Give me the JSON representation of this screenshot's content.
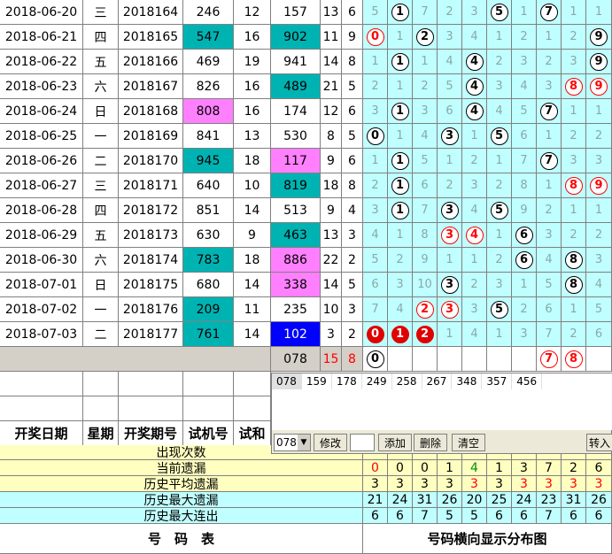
{
  "colors": {
    "teal": "#00b3b3",
    "pink": "#ff80ff",
    "blue": "#0000ff",
    "dist_bg": "#c0ffff",
    "ball_red": "#e00000"
  },
  "rows": [
    {
      "date": "2018-06-20",
      "weekday": "三",
      "issue": "2018164",
      "trial": "246",
      "trial_sum": "12",
      "draw": "157",
      "draw_sum": "13",
      "span": "6",
      "trial_style": "",
      "draw_style": "",
      "dist": [
        {
          "t": "5"
        },
        {
          "t": "1",
          "b": "blk"
        },
        {
          "t": "7"
        },
        {
          "t": "2"
        },
        {
          "t": "3"
        },
        {
          "t": "5",
          "b": "blk"
        },
        {
          "t": "1"
        },
        {
          "t": "7",
          "b": "blk"
        },
        {
          "t": "1"
        },
        {
          "t": "1"
        }
      ]
    },
    {
      "date": "2018-06-21",
      "weekday": "四",
      "issue": "2018165",
      "trial": "547",
      "trial_sum": "16",
      "draw": "902",
      "draw_sum": "11",
      "span": "9",
      "trial_style": "teal",
      "draw_style": "teal",
      "dist": [
        {
          "t": "0",
          "b": "red"
        },
        {
          "t": "1"
        },
        {
          "t": "2",
          "b": "blk"
        },
        {
          "t": "3"
        },
        {
          "t": "4"
        },
        {
          "t": "1"
        },
        {
          "t": "2"
        },
        {
          "t": "1"
        },
        {
          "t": "2"
        },
        {
          "t": "9",
          "b": "blk"
        }
      ]
    },
    {
      "date": "2018-06-22",
      "weekday": "五",
      "issue": "2018166",
      "trial": "469",
      "trial_sum": "19",
      "draw": "941",
      "draw_sum": "14",
      "span": "8",
      "trial_style": "",
      "draw_style": "",
      "dist": [
        {
          "t": "1"
        },
        {
          "t": "1",
          "b": "blk"
        },
        {
          "t": "1"
        },
        {
          "t": "4"
        },
        {
          "t": "4",
          "b": "blk"
        },
        {
          "t": "2"
        },
        {
          "t": "3"
        },
        {
          "t": "2"
        },
        {
          "t": "3"
        },
        {
          "t": "9",
          "b": "blk"
        }
      ]
    },
    {
      "date": "2018-06-23",
      "weekday": "六",
      "issue": "2018167",
      "trial": "826",
      "trial_sum": "16",
      "draw": "489",
      "draw_sum": "21",
      "span": "5",
      "trial_style": "",
      "draw_style": "teal",
      "dist": [
        {
          "t": "2"
        },
        {
          "t": "1"
        },
        {
          "t": "2"
        },
        {
          "t": "5"
        },
        {
          "t": "4",
          "b": "blk"
        },
        {
          "t": "3"
        },
        {
          "t": "4"
        },
        {
          "t": "3"
        },
        {
          "t": "8",
          "b": "red"
        },
        {
          "t": "9",
          "b": "red"
        }
      ]
    },
    {
      "date": "2018-06-24",
      "weekday": "日",
      "issue": "2018168",
      "trial": "808",
      "trial_sum": "16",
      "draw": "174",
      "draw_sum": "12",
      "span": "6",
      "trial_style": "pink",
      "draw_style": "",
      "dist": [
        {
          "t": "3"
        },
        {
          "t": "1",
          "b": "blk"
        },
        {
          "t": "3"
        },
        {
          "t": "6"
        },
        {
          "t": "4",
          "b": "blk"
        },
        {
          "t": "4"
        },
        {
          "t": "5"
        },
        {
          "t": "7",
          "b": "blk"
        },
        {
          "t": "1"
        },
        {
          "t": "1"
        }
      ]
    },
    {
      "date": "2018-06-25",
      "weekday": "一",
      "issue": "2018169",
      "trial": "841",
      "trial_sum": "13",
      "draw": "530",
      "draw_sum": "8",
      "span": "5",
      "trial_style": "",
      "draw_style": "",
      "dist": [
        {
          "t": "0",
          "b": "blk"
        },
        {
          "t": "1"
        },
        {
          "t": "4"
        },
        {
          "t": "3",
          "b": "blk"
        },
        {
          "t": "1"
        },
        {
          "t": "5",
          "b": "blk"
        },
        {
          "t": "6"
        },
        {
          "t": "1"
        },
        {
          "t": "2"
        },
        {
          "t": "2"
        }
      ]
    },
    {
      "date": "2018-06-26",
      "weekday": "二",
      "issue": "2018170",
      "trial": "945",
      "trial_sum": "18",
      "draw": "117",
      "draw_sum": "9",
      "span": "6",
      "trial_style": "teal",
      "draw_style": "pink",
      "dist": [
        {
          "t": "1"
        },
        {
          "t": "1",
          "b": "blk"
        },
        {
          "t": "5"
        },
        {
          "t": "1"
        },
        {
          "t": "2"
        },
        {
          "t": "1"
        },
        {
          "t": "7"
        },
        {
          "t": "7",
          "b": "blk"
        },
        {
          "t": "3"
        },
        {
          "t": "3"
        }
      ]
    },
    {
      "date": "2018-06-27",
      "weekday": "三",
      "issue": "2018171",
      "trial": "640",
      "trial_sum": "10",
      "draw": "819",
      "draw_sum": "18",
      "span": "8",
      "trial_style": "",
      "draw_style": "teal",
      "dist": [
        {
          "t": "2"
        },
        {
          "t": "1",
          "b": "blk"
        },
        {
          "t": "6"
        },
        {
          "t": "2"
        },
        {
          "t": "3"
        },
        {
          "t": "2"
        },
        {
          "t": "8"
        },
        {
          "t": "1"
        },
        {
          "t": "8",
          "b": "red"
        },
        {
          "t": "9",
          "b": "red"
        }
      ]
    },
    {
      "date": "2018-06-28",
      "weekday": "四",
      "issue": "2018172",
      "trial": "851",
      "trial_sum": "14",
      "draw": "513",
      "draw_sum": "9",
      "span": "4",
      "trial_style": "",
      "draw_style": "",
      "dist": [
        {
          "t": "3"
        },
        {
          "t": "1",
          "b": "blk"
        },
        {
          "t": "7"
        },
        {
          "t": "3",
          "b": "blk"
        },
        {
          "t": "4"
        },
        {
          "t": "5",
          "b": "blk"
        },
        {
          "t": "9"
        },
        {
          "t": "2"
        },
        {
          "t": "1"
        },
        {
          "t": "1"
        }
      ]
    },
    {
      "date": "2018-06-29",
      "weekday": "五",
      "issue": "2018173",
      "trial": "630",
      "trial_sum": "9",
      "draw": "463",
      "draw_sum": "13",
      "span": "3",
      "trial_style": "",
      "draw_style": "teal",
      "dist": [
        {
          "t": "4"
        },
        {
          "t": "1"
        },
        {
          "t": "8"
        },
        {
          "t": "3",
          "b": "red"
        },
        {
          "t": "4",
          "b": "red"
        },
        {
          "t": "1"
        },
        {
          "t": "6",
          "b": "blk"
        },
        {
          "t": "3"
        },
        {
          "t": "2"
        },
        {
          "t": "2"
        }
      ]
    },
    {
      "date": "2018-06-30",
      "weekday": "六",
      "issue": "2018174",
      "trial": "783",
      "trial_sum": "18",
      "draw": "886",
      "draw_sum": "22",
      "span": "2",
      "trial_style": "teal",
      "draw_style": "pink",
      "dist": [
        {
          "t": "5"
        },
        {
          "t": "2"
        },
        {
          "t": "9"
        },
        {
          "t": "1"
        },
        {
          "t": "1"
        },
        {
          "t": "2"
        },
        {
          "t": "6",
          "b": "blk"
        },
        {
          "t": "4"
        },
        {
          "t": "8",
          "b": "blk"
        },
        {
          "t": "3"
        }
      ]
    },
    {
      "date": "2018-07-01",
      "weekday": "日",
      "issue": "2018175",
      "trial": "680",
      "trial_sum": "14",
      "draw": "338",
      "draw_sum": "14",
      "span": "5",
      "trial_style": "",
      "draw_style": "pink",
      "dist": [
        {
          "t": "6"
        },
        {
          "t": "3"
        },
        {
          "t": "10"
        },
        {
          "t": "3",
          "b": "blk"
        },
        {
          "t": "2"
        },
        {
          "t": "3"
        },
        {
          "t": "1"
        },
        {
          "t": "5"
        },
        {
          "t": "8",
          "b": "blk"
        },
        {
          "t": "4"
        }
      ]
    },
    {
      "date": "2018-07-02",
      "weekday": "一",
      "issue": "2018176",
      "trial": "209",
      "trial_sum": "11",
      "draw": "235",
      "draw_sum": "10",
      "span": "3",
      "trial_style": "teal",
      "draw_style": "",
      "dist": [
        {
          "t": "7"
        },
        {
          "t": "4"
        },
        {
          "t": "2",
          "b": "red"
        },
        {
          "t": "3",
          "b": "red"
        },
        {
          "t": "3"
        },
        {
          "t": "5",
          "b": "blk"
        },
        {
          "t": "2"
        },
        {
          "t": "6"
        },
        {
          "t": "1"
        },
        {
          "t": "5"
        }
      ]
    },
    {
      "date": "2018-07-03",
      "weekday": "二",
      "issue": "2018177",
      "trial": "761",
      "trial_sum": "14",
      "draw": "102",
      "draw_sum": "3",
      "span": "2",
      "trial_style": "teal",
      "draw_style": "blue",
      "dist": [
        {
          "t": "0",
          "b": "fill"
        },
        {
          "t": "1",
          "b": "fill"
        },
        {
          "t": "2",
          "b": "fill"
        },
        {
          "t": "1"
        },
        {
          "t": "4"
        },
        {
          "t": "1"
        },
        {
          "t": "3"
        },
        {
          "t": "7"
        },
        {
          "t": "2"
        },
        {
          "t": "6"
        }
      ]
    }
  ],
  "next_row": {
    "draw": "078",
    "draw_sum": "15",
    "span": "8",
    "balls": [
      {
        "idx": 0,
        "t": "0",
        "b": "blk"
      },
      {
        "idx": 7,
        "t": "7",
        "b": "red"
      },
      {
        "idx": 8,
        "t": "8",
        "b": "red"
      }
    ]
  },
  "headers": {
    "date": "开奖日期",
    "weekday": "星期",
    "issue": "开奖期号",
    "trial": "试机号",
    "trial_sum": "试和"
  },
  "panel": {
    "list": [
      "078",
      "159",
      "178",
      "249",
      "258",
      "267",
      "348",
      "357",
      "456"
    ],
    "combo_value": "078",
    "edit_btn": "修改",
    "add_btn": "添加",
    "delete_btn": "删除",
    "clear_btn": "清空",
    "import_btn": "转入"
  },
  "stats": [
    {
      "label": "出现次数",
      "values": [
        "",
        "",
        "",
        "",
        "",
        "",
        "",
        "",
        "",
        ""
      ],
      "bg": "yellow"
    },
    {
      "label": "当前遗漏",
      "values": [
        "0",
        "0",
        "0",
        "1",
        "4",
        "1",
        "3",
        "7",
        "2",
        "6"
      ],
      "bg": "yellow",
      "colors": [
        "red",
        "",
        "",
        "",
        "green",
        "",
        "",
        "",
        "",
        ""
      ]
    },
    {
      "label": "历史平均遗漏",
      "values": [
        "3",
        "3",
        "3",
        "3",
        "3",
        "3",
        "3",
        "3",
        "3",
        "3"
      ],
      "bg": "yellow",
      "colors": [
        "",
        "",
        "",
        "",
        "red",
        "",
        "red",
        "red",
        "red",
        "red"
      ]
    },
    {
      "label": "历史最大遗漏",
      "values": [
        "21",
        "24",
        "31",
        "26",
        "20",
        "25",
        "24",
        "23",
        "31",
        "26"
      ],
      "bg": "cyan"
    },
    {
      "label": "历史最大连出",
      "values": [
        "6",
        "6",
        "7",
        "5",
        "5",
        "6",
        "6",
        "7",
        "6",
        "6"
      ],
      "bg": "cyan"
    }
  ],
  "footer": {
    "left": "号　码　表",
    "right": "号码横向显示分布图"
  }
}
